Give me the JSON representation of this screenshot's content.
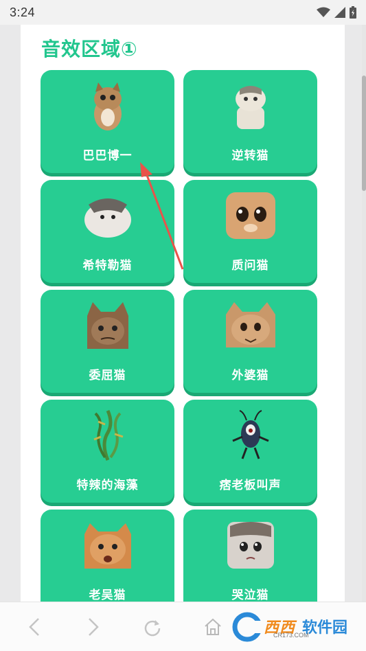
{
  "status_bar": {
    "time": "3:24"
  },
  "section": {
    "title": "音效区域①"
  },
  "cards": [
    {
      "label": "巴巴博一",
      "icon": "cat-sticker-icon"
    },
    {
      "label": "逆转猫",
      "icon": "cat-sticker-icon"
    },
    {
      "label": "希特勒猫",
      "icon": "cat-sticker-icon"
    },
    {
      "label": "质问猫",
      "icon": "cat-sticker-icon"
    },
    {
      "label": "委屈猫",
      "icon": "cat-sticker-icon"
    },
    {
      "label": "外婆猫",
      "icon": "cat-sticker-icon"
    },
    {
      "label": "特辣的海藻",
      "icon": "seaweed-sticker-icon"
    },
    {
      "label": "痞老板叫声",
      "icon": "plankton-sticker-icon"
    },
    {
      "label": "老吴猫",
      "icon": "cat-sticker-icon"
    },
    {
      "label": "哭泣猫",
      "icon": "cat-sticker-icon"
    }
  ],
  "bottom_nav": [
    "back-icon",
    "forward-icon",
    "refresh-icon",
    "home-icon"
  ],
  "watermark": {
    "text_orange": "西西",
    "text_blue": "软件园",
    "url": "CR173.COM"
  },
  "colors": {
    "card": "#27cd92",
    "title": "#22c68e",
    "annotation": "#e8534a"
  }
}
